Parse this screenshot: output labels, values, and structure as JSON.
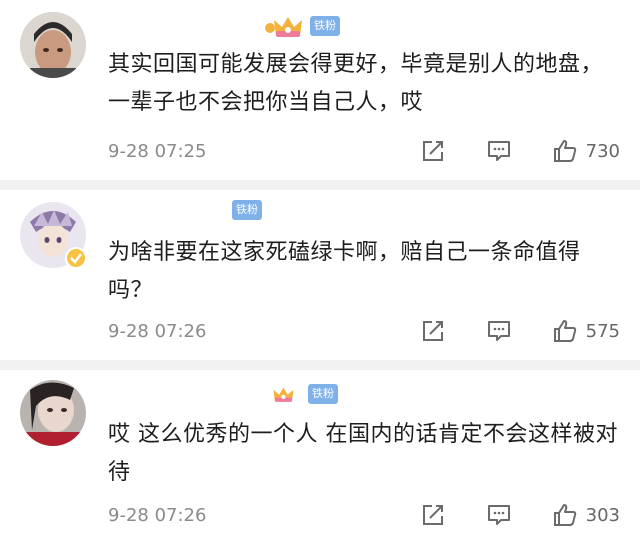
{
  "comments": [
    {
      "avatar": "avatar-man-photo",
      "has_crown": true,
      "fan_badge": "铁粉",
      "text": "其实回国可能发展会得更好，毕竟是别人的地盘，一辈子也不会把你当自己人，哎",
      "time": "9-28 07:25",
      "likes": "730"
    },
    {
      "avatar": "avatar-anime-verified",
      "has_crown": false,
      "fan_badge": "铁粉",
      "text": "为啥非要在这家死磕绿卡啊，赔自己一条命值得吗？",
      "time": "9-28 07:26",
      "likes": "575"
    },
    {
      "avatar": "avatar-girl-photo",
      "has_crown": true,
      "fan_badge": "铁粉",
      "text": "哎 这么优秀的一个人 在国内的话肯定不会这样被对待",
      "time": "9-28 07:26",
      "likes": "303"
    }
  ],
  "icons": {
    "share": "share-icon",
    "reply": "comment-icon",
    "like": "thumbs-up-icon"
  },
  "colors": {
    "fan_badge_bg": "#7fb0e8",
    "crown_gold": "#f2b33d",
    "crown_pink": "#f07a9a",
    "icon_gray": "#6b6b6b"
  }
}
